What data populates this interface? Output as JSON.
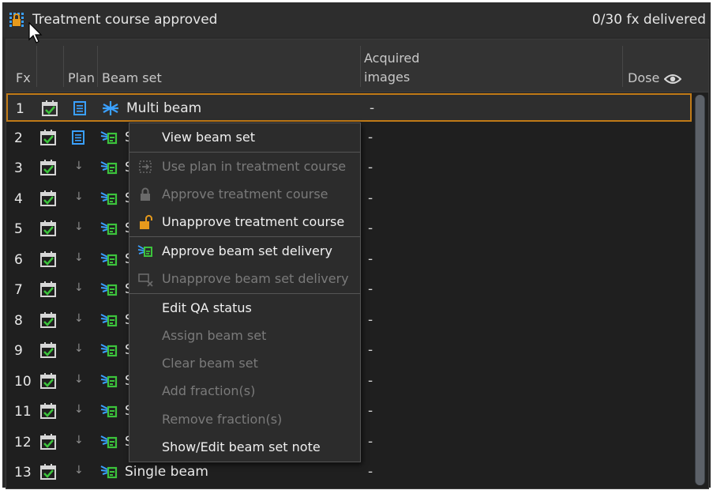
{
  "header": {
    "title": "Treatment course approved",
    "fx_delivered": "0/30 fx delivered"
  },
  "columns": {
    "fx": "Fx",
    "plan": "Plan",
    "beam_set": "Beam set",
    "acquired_line1": "Acquired",
    "acquired_line2": "images",
    "dose": "Dose"
  },
  "rows": [
    {
      "fx": "1",
      "beam": "Multi beam",
      "acquired": "-",
      "plan_icon": "document-icon"
    },
    {
      "fx": "2",
      "beam": "Single beam",
      "acquired": "-",
      "plan_icon": "document-icon"
    },
    {
      "fx": "3",
      "beam": "Single beam",
      "acquired": "-",
      "plan_icon": "arrow-down-icon"
    },
    {
      "fx": "4",
      "beam": "Single beam",
      "acquired": "-",
      "plan_icon": "arrow-down-icon"
    },
    {
      "fx": "5",
      "beam": "Single beam",
      "acquired": "-",
      "plan_icon": "arrow-down-icon"
    },
    {
      "fx": "6",
      "beam": "Single beam",
      "acquired": "-",
      "plan_icon": "arrow-down-icon"
    },
    {
      "fx": "7",
      "beam": "Single beam",
      "acquired": "-",
      "plan_icon": "arrow-down-icon"
    },
    {
      "fx": "8",
      "beam": "Single beam",
      "acquired": "-",
      "plan_icon": "arrow-down-icon"
    },
    {
      "fx": "9",
      "beam": "Single beam",
      "acquired": "-",
      "plan_icon": "arrow-down-icon"
    },
    {
      "fx": "10",
      "beam": "Single beam",
      "acquired": "-",
      "plan_icon": "arrow-down-icon"
    },
    {
      "fx": "11",
      "beam": "Single beam",
      "acquired": "-",
      "plan_icon": "arrow-down-icon"
    },
    {
      "fx": "12",
      "beam": "Single beam",
      "acquired": "-",
      "plan_icon": "arrow-down-icon"
    },
    {
      "fx": "13",
      "beam": "Single beam",
      "acquired": "-",
      "plan_icon": "arrow-down-icon"
    }
  ],
  "context_menu": {
    "items": [
      {
        "label": "View beam set",
        "enabled": true,
        "icon": ""
      },
      {
        "label": "Use plan in treatment course",
        "enabled": false,
        "icon": "use-plan-icon"
      },
      {
        "label": "Approve treatment course",
        "enabled": false,
        "icon": "lock-icon"
      },
      {
        "label": "Unapprove treatment course",
        "enabled": true,
        "icon": "unlock-icon"
      },
      {
        "label": "Approve beam set delivery",
        "enabled": true,
        "icon": "beam-approve-icon"
      },
      {
        "label": "Unapprove beam set delivery",
        "enabled": false,
        "icon": "beam-unapprove-icon"
      },
      {
        "label": "Edit QA status",
        "enabled": true,
        "icon": ""
      },
      {
        "label": "Assign beam set",
        "enabled": false,
        "icon": ""
      },
      {
        "label": "Clear beam set",
        "enabled": false,
        "icon": ""
      },
      {
        "label": "Add fraction(s)",
        "enabled": false,
        "icon": ""
      },
      {
        "label": "Remove fraction(s)",
        "enabled": false,
        "icon": ""
      },
      {
        "label": "Show/Edit beam set note",
        "enabled": true,
        "icon": ""
      }
    ]
  },
  "colors": {
    "selection_border": "#c07a17",
    "accent_blue": "#3aa0ff",
    "accent_green": "#3cc43c",
    "lock_orange": "#e69a1c"
  }
}
